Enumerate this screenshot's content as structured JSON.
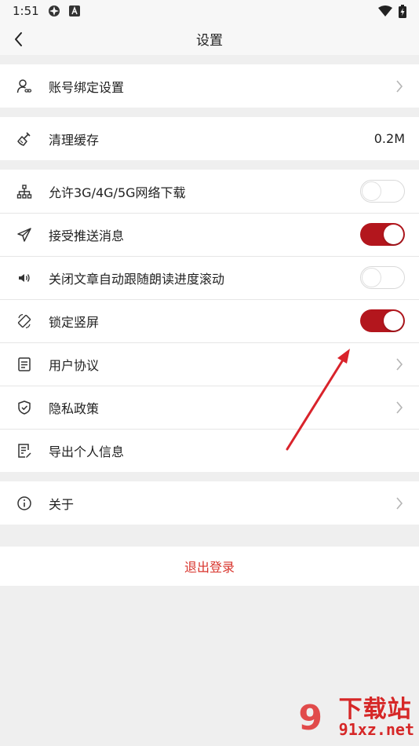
{
  "status_bar": {
    "time": "1:51"
  },
  "nav": {
    "title": "设置"
  },
  "groups": {
    "account": {
      "label": "账号绑定设置"
    },
    "cache": {
      "label": "清理缓存",
      "value": "0.2M"
    },
    "download": {
      "label": "允许3G/4G/5G网络下载",
      "on": false
    },
    "push": {
      "label": "接受推送消息",
      "on": true
    },
    "autoscroll": {
      "label": "关闭文章自动跟随朗读进度滚动",
      "on": false
    },
    "lock": {
      "label": "锁定竖屏",
      "on": true
    },
    "agreement": {
      "label": "用户协议"
    },
    "privacy": {
      "label": "隐私政策"
    },
    "export": {
      "label": "导出个人信息"
    },
    "about": {
      "label": "关于"
    }
  },
  "logout": {
    "label": "退出登录"
  },
  "watermark": {
    "brand": "下载站",
    "url": "91xz.net",
    "logo": "9"
  },
  "colors": {
    "accent": "#b3161d",
    "logout": "#d8342c",
    "annotation_arrow": "#d9232b"
  }
}
